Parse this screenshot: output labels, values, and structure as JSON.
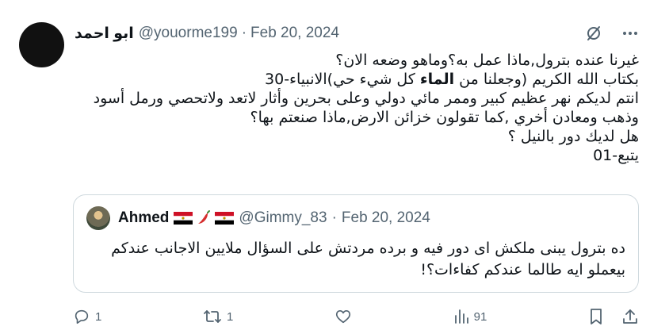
{
  "author": {
    "display_name": "ابو احمد",
    "handle": "@youorme199",
    "separator": "·",
    "date": "Feb 20, 2024"
  },
  "tweet": {
    "lines": [
      "غيرنا عنده بترول,ماذا عمل به؟وماهو وضعه الان؟",
      {
        "before": "بكتاب الله الكريم (وجعلنا من ",
        "bold": "الماء",
        "after": " كل شيء حي)الانبياء-30"
      },
      "انتم لديكم نهر عظيم كبير وممر مائي دولي وعلى بحرين وأثار لاتعد ولاتحصي ورمل أسود",
      "وذهب ومعادن أخري ,كما تقولون خزائن الارض,ماذا صنعتم بها؟",
      "هل لديك دور بالنيل ؟",
      "يتبع-01"
    ]
  },
  "quoted": {
    "name": "Ahmed",
    "handle": "@Gimmy_83",
    "separator": "·",
    "date": "Feb 20, 2024",
    "text_lines": [
      "ده بترول يبنى ملكش اى دور فيه و برده مردتش على السؤال ملايين الاجانب عندكم",
      "بيعملو ايه طالما عندكم كفاءات؟!"
    ]
  },
  "actions": {
    "replies": "1",
    "reposts": "1",
    "views": "91"
  },
  "icons": {
    "grok": "grok-slash-icon",
    "more": "more-dots-icon",
    "reply": "reply-icon",
    "repost": "repost-icon",
    "like": "heart-icon",
    "views": "views-chart-icon",
    "bookmark": "bookmark-icon",
    "share": "share-icon"
  },
  "colors": {
    "text": "#0f1419",
    "secondary": "#536471",
    "border": "#cfd9de",
    "avatar": "#111111"
  }
}
